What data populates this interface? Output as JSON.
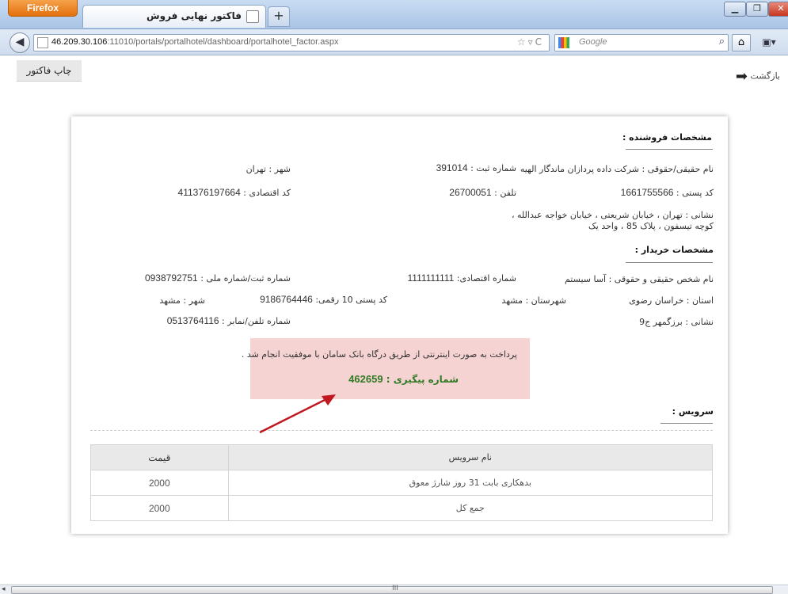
{
  "browser": {
    "app_button": "Firefox",
    "tab_title": "فاکتور نهایی فروش",
    "new_tab": "+",
    "url_host": "46.209.30.106",
    "url_rest": ":11010/portals/portalhotel/dashboard/portalhotel_factor.aspx",
    "search_placeholder": "Google"
  },
  "toolbar": {
    "print_label": "چاپ فاکتور",
    "back_label": "بازگشت"
  },
  "seller": {
    "heading": "مشخصات فروشنده :",
    "name_label": "نام حقیقی/حقوقی : شرکت داده پردازان ماندگار الهیه",
    "reg_label": "شماره ثبت :",
    "reg_value": "391014",
    "city_label": "شهر : تهران",
    "postal_label": "کد پستی :",
    "postal_value": "1661755566",
    "phone_label": "تلفن :",
    "phone_value": "26700051",
    "econ_label": "کد اقتصادی :",
    "econ_value": "411376197664",
    "address_line1": "نشانی : تهران ، خیابان شریعتی ، خیابان خواجه عبدالله ،",
    "address_line2": "کوچه تیسفون ، پلاک 85 ، واحد یک"
  },
  "buyer": {
    "heading": "مشخصات خریدار :",
    "name_label": "نام شخص حقیقی و حقوقی : آسا سیستم",
    "econ_label": "شماره اقتصادی:",
    "econ_value": "1111111111",
    "national_label": "شماره ثبت/شماره ملی :",
    "national_value": "0938792751",
    "province_label": "استان : خراسان رضوی",
    "county_label": "شهرستان : مشهد",
    "postal_label": "کد پستی 10 رقمی:",
    "postal_value": "9186764446",
    "city_label": "شهر : مشهد",
    "address_label": "نشانی : برزگمهر ج9",
    "phone_label": "شماره تلفن/نمابر :",
    "phone_value": "0513764116"
  },
  "payment": {
    "success_message": "پرداخت به صورت اینترنتی از طریق درگاه بانک سامان با موفقیت انجام شد .",
    "tracking_label": "شماره پیگیری :",
    "tracking_value": "462659"
  },
  "services": {
    "heading": "سرویس :",
    "columns": {
      "name": "نام سرویس",
      "price": "قیمت"
    },
    "rows": [
      {
        "name": "بدهکاری بابت 31 روز شارژ معوق",
        "price": "2000"
      }
    ],
    "total": {
      "name": "جمع کل",
      "price": "2000"
    }
  },
  "colors": {
    "success_bg": "#f5d3d3",
    "tracking_text": "#2f7a22",
    "annotation_arrow": "#c0181e"
  }
}
